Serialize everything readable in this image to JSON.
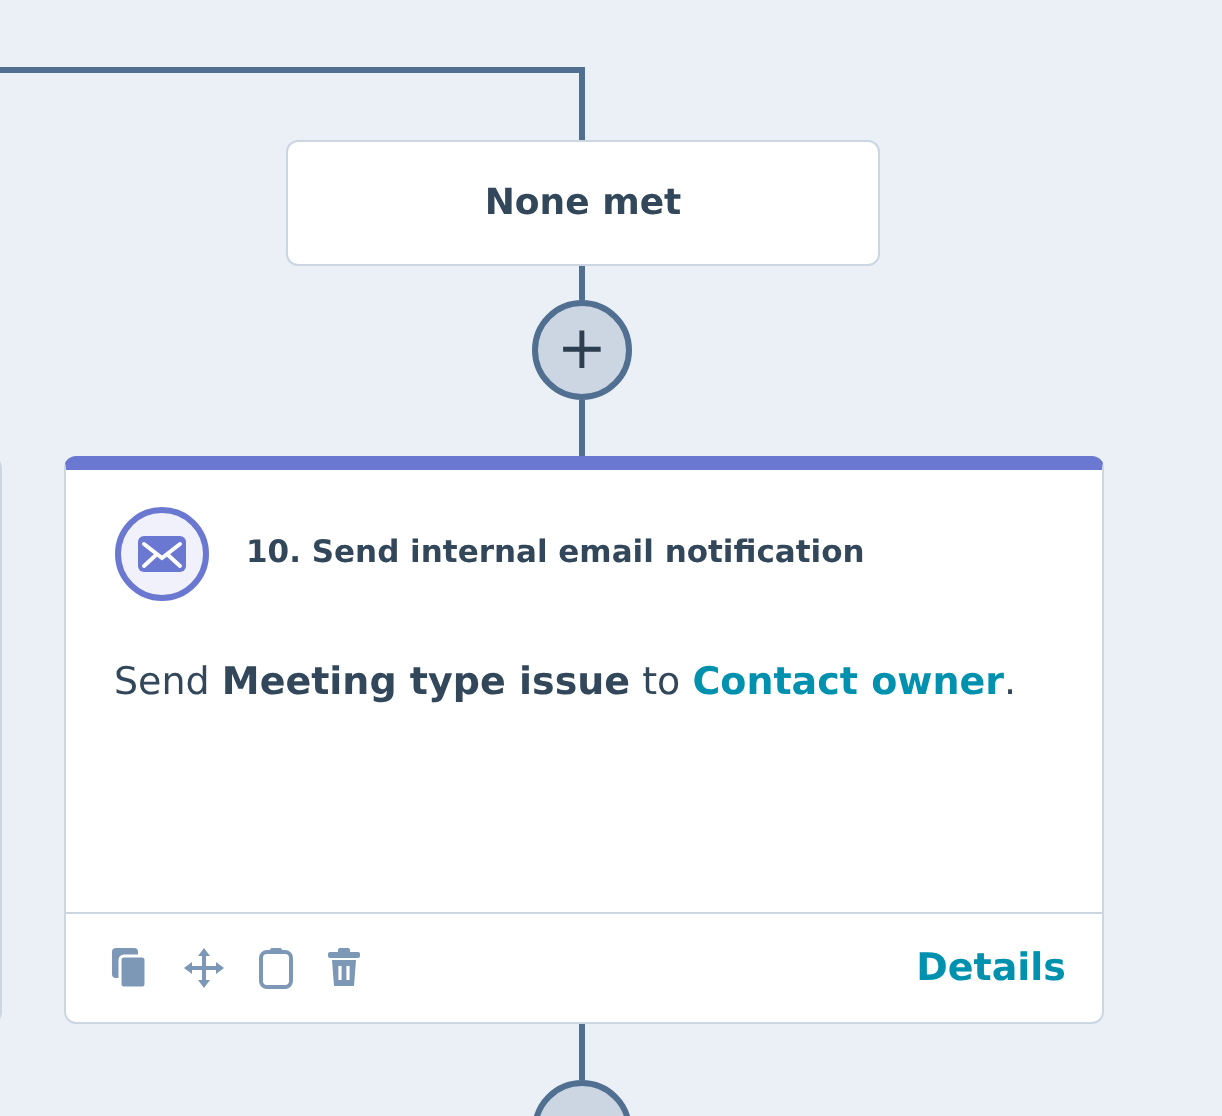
{
  "branch": {
    "label": "None met"
  },
  "add_button": {
    "label": "+"
  },
  "action": {
    "title": "10. Send internal email notification",
    "body": {
      "before": "Send **Meeting type issue** to",
      "link": "Contact owner",
      "after": "."
    },
    "details_link": "Details"
  },
  "next_add_button": {
    "kind": "partial"
  }
}
